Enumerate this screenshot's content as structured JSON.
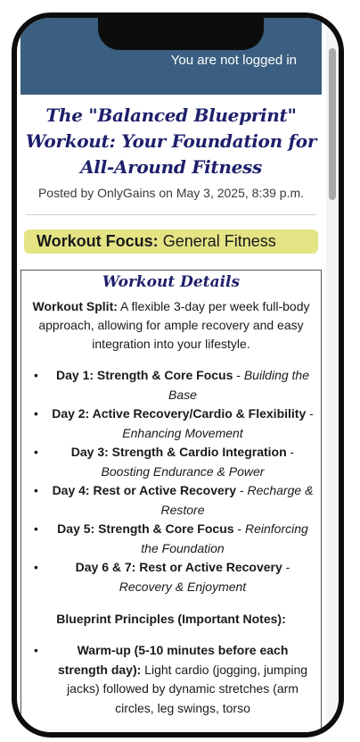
{
  "header": {
    "login_status": "You are not logged in"
  },
  "post": {
    "title": "The \"Balanced Blueprint\" Workout: Your Foundation for All-Around Fitness",
    "meta": "Posted by OnlyGains on May 3, 2025, 8:39 p.m."
  },
  "focus": {
    "label": "Workout Focus:",
    "value": "General Fitness"
  },
  "details": {
    "heading": "Workout Details",
    "split_label": "Workout Split:",
    "split_text": "A flexible 3-day per week full-body approach, allowing for ample recovery and easy integration into your lifestyle.",
    "days": [
      {
        "name": "Day 1: Strength & Core Focus",
        "desc": "Building the Base"
      },
      {
        "name": "Day 2: Active Recovery/Cardio & Flexibility",
        "desc": "Enhancing Movement"
      },
      {
        "name": "Day 3: Strength & Cardio Integration",
        "desc": "Boosting Endurance & Power"
      },
      {
        "name": "Day 4: Rest or Active Recovery",
        "desc": "Recharge & Restore"
      },
      {
        "name": "Day 5: Strength & Core Focus",
        "desc": "Reinforcing the Foundation"
      },
      {
        "name": "Day 6 & 7: Rest or Active Recovery",
        "desc": "Recovery & Enjoyment"
      }
    ],
    "separator": " - ",
    "principles_heading": "Blueprint Principles (Important Notes):",
    "principles": [
      {
        "name": "Warm-up (5-10 minutes before each strength day):",
        "text": "Light cardio (jogging, jumping jacks) followed by dynamic stretches (arm circles, leg swings, torso"
      }
    ]
  },
  "colors": {
    "header_bg": "#3b5f80",
    "title_color": "#1d1f6b",
    "focus_bg": "#e4e485"
  }
}
